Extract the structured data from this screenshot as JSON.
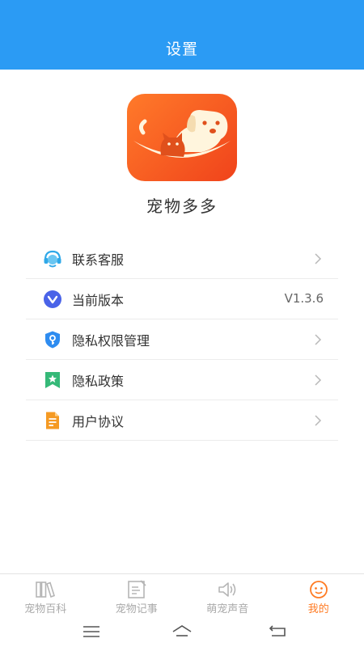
{
  "header": {
    "title": "设置"
  },
  "app": {
    "name": "宠物多多",
    "logo_icon": "pet-logo-icon"
  },
  "menu": [
    {
      "label": "联系客服",
      "icon": "customer-service-icon"
    },
    {
      "label": "当前版本",
      "icon": "version-icon",
      "value": "V1.3.6"
    },
    {
      "label": "隐私权限管理",
      "icon": "privacy-permission-icon"
    },
    {
      "label": "隐私政策",
      "icon": "privacy-policy-icon"
    },
    {
      "label": "用户协议",
      "icon": "user-agreement-icon"
    }
  ],
  "tabbar": [
    {
      "label": "宠物百科",
      "icon": "books-icon",
      "active": false
    },
    {
      "label": "宠物记事",
      "icon": "notes-icon",
      "active": false
    },
    {
      "label": "萌宠声音",
      "icon": "speaker-icon",
      "active": false
    },
    {
      "label": "我的",
      "icon": "profile-icon",
      "active": true
    }
  ],
  "system_nav": [
    "menu-icon",
    "home-icon",
    "back-icon"
  ],
  "colors": {
    "header": "#2b9bf4",
    "accent": "#ff7b23",
    "logo": "#f0431b"
  }
}
